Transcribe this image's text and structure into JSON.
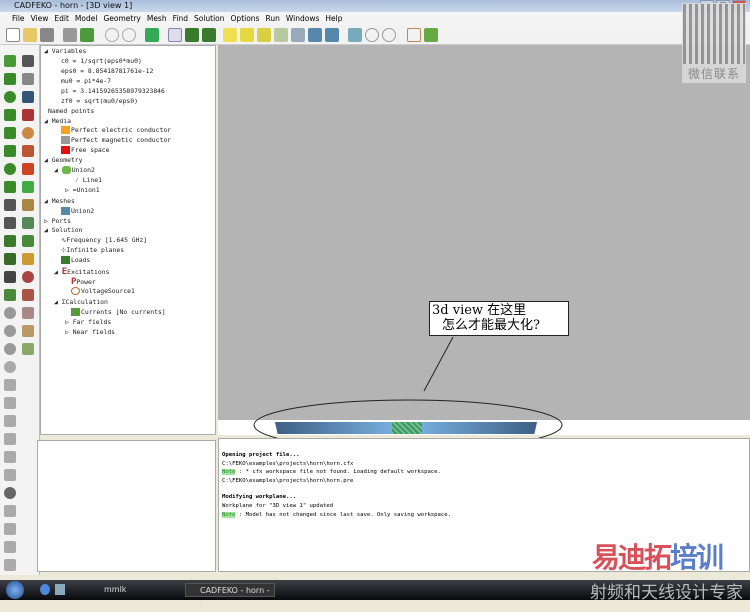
{
  "window": {
    "title": "CADFEKO - horn - [3D view 1]"
  },
  "menu": [
    "File",
    "View",
    "Edit",
    "Model",
    "Geometry",
    "Mesh",
    "Find",
    "Solution",
    "Options",
    "Run",
    "Windows",
    "Help"
  ],
  "tree": {
    "variables": "Variables",
    "vars": [
      "c0 = 1/sqrt(eps0*mu0)",
      "eps0 = 8.85418781761e-12",
      "mu0 = pi*4e-7",
      "pi = 3.14159265358979323846",
      "zf0 = sqrt(mu0/eps0)"
    ],
    "named_points": "Named points",
    "media": "Media",
    "media_items": [
      {
        "label": "Perfect electric conductor",
        "color": "#f5a21c"
      },
      {
        "label": "Perfect magnetic conductor",
        "color": "#999999"
      },
      {
        "label": "Free space",
        "color": "#e01010"
      }
    ],
    "geometry": "Geometry",
    "union2": "Union2",
    "line1": "Line1",
    "union1": "Union1",
    "meshes": "Meshes",
    "mesh_union2": "Union2",
    "ports": "Ports",
    "solution": "Solution",
    "frequency": "Frequency [1.645 GHz]",
    "infinite_planes": "Infinite planes",
    "loads": "Loads",
    "excitations": "Excitations",
    "power": "Power",
    "voltage_source": "VoltageSource1",
    "calculation": "Calculation",
    "currents": "Currents [No currents]",
    "far_fields": "Far fields",
    "near_fields": "Near fields"
  },
  "callout": {
    "line1": "3d view 在这里",
    "line2": "怎么才能最大化?"
  },
  "messages": {
    "l1": "Opening project file...",
    "l2": "C:\\FEKO\\examples\\projects\\horn\\horn.cfx",
    "note_label": "Note",
    "l3": " : * cfx workspace file not found. Loading default workspace.",
    "l4": "C:\\FEKO\\examples\\projects\\horn\\horn.pre",
    "l5": "Modifying workplane...",
    "l6": "Workplane for \"3D view 1\" updated",
    "l7": " : Model has not changed since last save. Only saving workspace."
  },
  "taskbar": {
    "folder": "mmlk",
    "app": "CADFEKO - horn - [..."
  },
  "watermark": {
    "qr_caption": "微信联系",
    "brand_a": "易迪拓",
    "brand_b": "培训",
    "slogan": "射频和天线设计专家"
  }
}
